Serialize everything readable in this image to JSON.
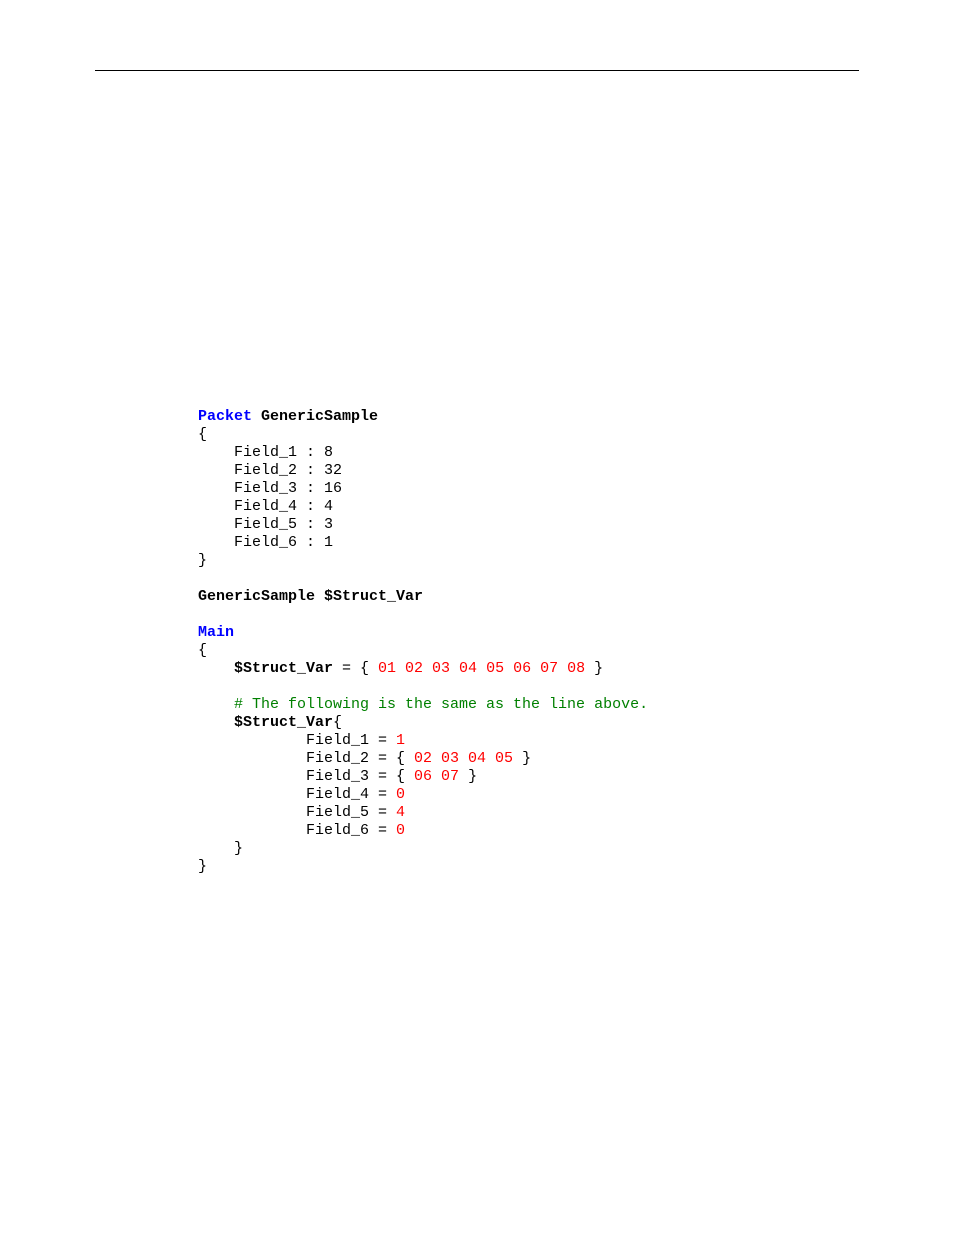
{
  "kw_packet": "Packet",
  "packet_name": "GenericSample",
  "lbrace": "{",
  "rbrace": "}",
  "fields": {
    "f1": "    Field_1 : 8",
    "f2": "    Field_2 : 32",
    "f3": "    Field_3 : 16",
    "f4": "    Field_4 : 4",
    "f5": "    Field_5 : 3",
    "f6": "    Field_6 : 1"
  },
  "decl": "GenericSample $Struct_Var",
  "kw_main": "Main",
  "main": {
    "sv_assign_name": "    $Struct_Var",
    "sv_eq": " = { ",
    "sv_bytes": "01 02 03 04 05 06 07 08",
    "sv_close": " }",
    "comment": "    # The following is the same as the line above.",
    "sv2_name": "    $Struct_Var",
    "sv2_brace": "{",
    "a1_l": "            Field_1 = ",
    "a1_v": "1",
    "a2_l": "            Field_2 = { ",
    "a2_v": "02 03 04 05",
    "a2_c": " }",
    "a3_l": "            Field_3 = { ",
    "a3_v": "06 07",
    "a3_c": " }",
    "a4_l": "            Field_4 = ",
    "a4_v": "0",
    "a5_l": "            Field_5 = ",
    "a5_v": "4",
    "a6_l": "            Field_6 = ",
    "a6_v": "0",
    "inner_close": "    }"
  }
}
